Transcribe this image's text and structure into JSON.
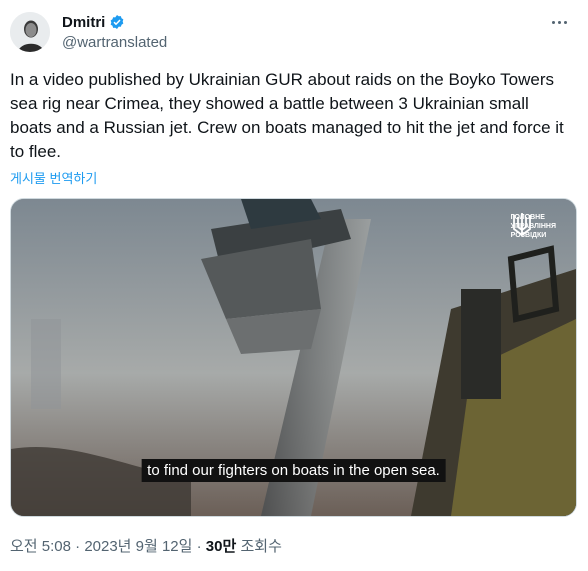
{
  "author": {
    "display_name": "Dmitri",
    "handle": "@wartranslated",
    "verified": true,
    "avatar_icon": "avatar-portrait-icon"
  },
  "more_icon": "more-options-icon",
  "tweet": {
    "text": "In a video published by Ukrainian GUR about raids on the Boyko Towers sea rig near Crimea, they showed a battle between 3 Ukrainian small boats and a Russian jet. Crew on boats managed to hit the jet and force it to flee.",
    "translate_label": "게시물 번역하기"
  },
  "media": {
    "subtitle": "to find our fighters on boats in the open sea.",
    "watermark_lines": [
      "ГОЛОВНЕ",
      "УПРАВЛІННЯ",
      "РОЗВІДКИ"
    ]
  },
  "meta": {
    "time": "오전 5:08",
    "sep1": " · ",
    "date": "2023년 9월 12일",
    "sep2": " · ",
    "views_count": "30만",
    "views_label": " 조회수"
  },
  "colors": {
    "accent": "#1d9bf0",
    "secondary_text": "#536471",
    "primary_text": "#0f1419"
  }
}
